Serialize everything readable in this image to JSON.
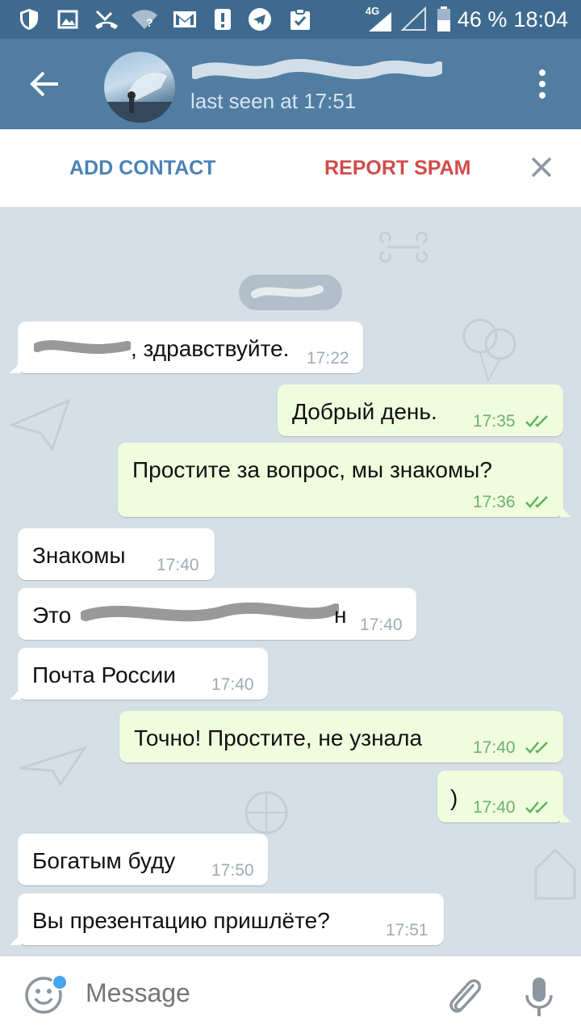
{
  "status_bar": {
    "network": "4G",
    "battery": "46 %",
    "time": "18:04",
    "icons": [
      "shield-icon",
      "image-icon",
      "missed-call-icon",
      "wifi-icon",
      "gmail-icon",
      "alert-icon",
      "telegram-icon",
      "clipboard-check-icon",
      "signal-icon",
      "battery-icon"
    ]
  },
  "header": {
    "last_seen": "last seen at 17:51",
    "colors": {
      "bar": "#517da2",
      "status": "#3f6a8f"
    }
  },
  "actions": {
    "add_contact": "ADD CONTACT",
    "report_spam": "REPORT SPAM"
  },
  "messages": [
    {
      "dir": "in",
      "text": ", здравствуйте.",
      "time": "17:22"
    },
    {
      "dir": "out",
      "text": "Добрый день.",
      "time": "17:35"
    },
    {
      "dir": "out",
      "text": "Простите за вопрос, мы знакомы?",
      "time": "17:36"
    },
    {
      "dir": "in",
      "text": "Знакомы",
      "time": "17:40"
    },
    {
      "dir": "in",
      "text": "Это",
      "tail_text": "н",
      "time": "17:40"
    },
    {
      "dir": "in",
      "text": "Почта России",
      "time": "17:40"
    },
    {
      "dir": "out",
      "text": "Точно! Простите, не узнала",
      "time": "17:40"
    },
    {
      "dir": "out",
      "text": ")",
      "time": "17:40"
    },
    {
      "dir": "in",
      "text": "Богатым буду",
      "time": "17:50"
    },
    {
      "dir": "in",
      "text": "Вы презентацию пришлёте?",
      "time": "17:51"
    }
  ],
  "input": {
    "placeholder": "Message"
  }
}
